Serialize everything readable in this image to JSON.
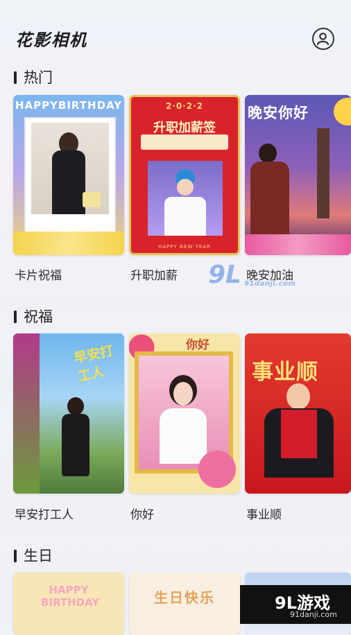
{
  "app": {
    "title": "花影相机"
  },
  "sections": [
    {
      "title": "热门",
      "cards": [
        {
          "label": "卡片祝福",
          "heading": "HAPPYBIRTHDAY"
        },
        {
          "label": "升职加薪",
          "heading": "升职加薪签",
          "year": "2·0·2·2",
          "footer": "HAPPY NEW YEAR"
        },
        {
          "label": "晚安加油",
          "heading": "晚安你好"
        }
      ]
    },
    {
      "title": "祝福",
      "cards": [
        {
          "label": "早安打工人",
          "heading": "早安打工人"
        },
        {
          "label": "你好",
          "heading": "你好"
        },
        {
          "label": "事业顺",
          "heading": "事业顺"
        }
      ]
    },
    {
      "title": "生日",
      "cards": [
        {
          "heading": "HAPPY BIRTHDAY"
        },
        {
          "heading": "生日快乐"
        },
        {
          "heading": ""
        }
      ]
    }
  ],
  "watermark": {
    "big": "9L",
    "small": "91danji.com",
    "logo": "9L游戏",
    "site": "91danji.com"
  },
  "colors": {
    "accent_red": "#d8232a",
    "gold": "#e7c35a",
    "purple": "#6a4aa8"
  },
  "icons": {
    "profile": "user-circle-icon"
  }
}
